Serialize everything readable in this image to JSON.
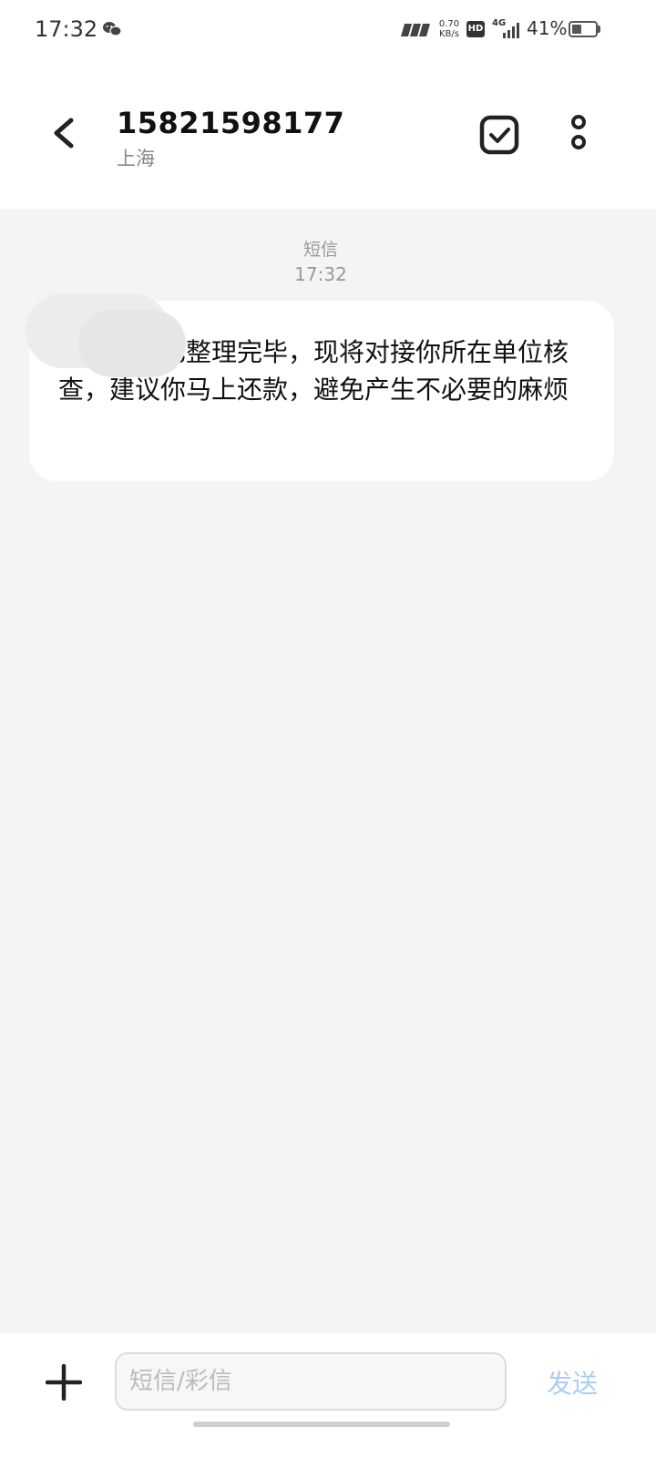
{
  "status_bar": {
    "time": "17:32",
    "speed_value": "0.70",
    "speed_unit": "KB/s",
    "hd_label": "HD",
    "network_label": "4G",
    "battery_text": "41%",
    "battery_level": 0.41
  },
  "header": {
    "contact_number": "15821598177",
    "contact_location": "上海",
    "back_icon": "chevron-left-icon",
    "select_icon": "checkbox-icon",
    "more_icon": "more-vertical-icon"
  },
  "conversation": {
    "message_type": "短信",
    "message_time": "17:32",
    "messages": [
      {
        "direction": "incoming",
        "text": "欠款材料已整理完毕，现将对接你所在单位核查，建议你马上还款，避免产生不必要的麻烦"
      }
    ]
  },
  "input_bar": {
    "add_icon": "plus-icon",
    "placeholder": "短信/彩信",
    "value": "",
    "send_label": "发送",
    "send_color": "#a9cdf2"
  }
}
